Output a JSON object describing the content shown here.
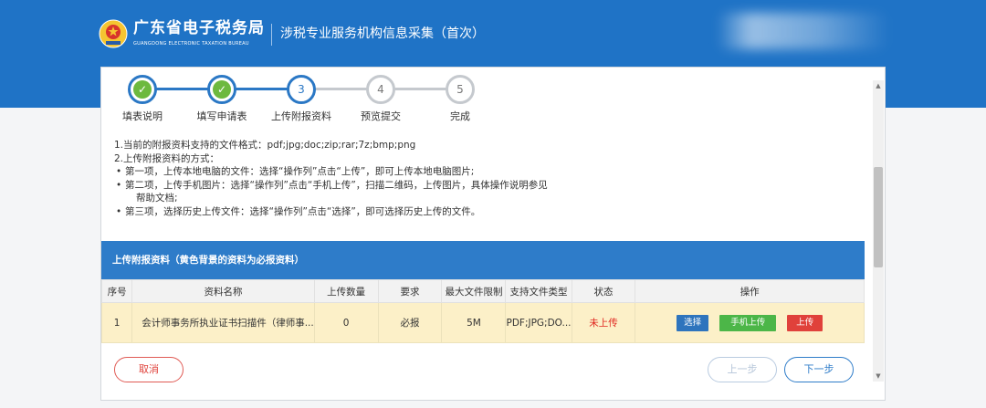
{
  "header": {
    "brand_cn": "广东省电子税务局",
    "brand_en": "GUANGDONG ELECTRONIC TAXATION BUREAU",
    "subtitle": "涉税专业服务机构信息采集（首次）",
    "emblem_icon": "tax-emblem-icon",
    "color": "#1f73c6"
  },
  "steps": [
    {
      "num": "1",
      "label": "填表说明",
      "state": "done"
    },
    {
      "num": "2",
      "label": "填写申请表",
      "state": "done"
    },
    {
      "num": "3",
      "label": "上传附报资料",
      "state": "current"
    },
    {
      "num": "4",
      "label": "预览提交",
      "state": "todo"
    },
    {
      "num": "5",
      "label": "完成",
      "state": "todo"
    }
  ],
  "instructions": {
    "line1": "1.当前的附报资料支持的文件格式：pdf;jpg;doc;zip;rar;7z;bmp;png",
    "line2": "2.上传附报资料的方式：",
    "bullet1": "第一项，上传本地电脑的文件：选择“操作列”点击“上传”，即可上传本地电脑图片;",
    "bullet2": "第二项，上传手机图片：选择“操作列”点击“手机上传”，扫描二维码，上传图片，具体操作说明参见",
    "bullet2_cont": "帮助文档;",
    "bullet3": "第三项，选择历史上传文件：选择“操作列”点击“选择”，即可选择历史上传的文件。"
  },
  "section_title": "上传附报资料（黄色背景的资料为必报资料）",
  "table": {
    "headers": [
      "序号",
      "资料名称",
      "上传数量",
      "要求",
      "最大文件限制",
      "支持文件类型",
      "状态",
      "操作"
    ],
    "rows": [
      {
        "index": "1",
        "name": "会计师事务所执业证书扫描件（律师事...",
        "count": "0",
        "requirement": "必报",
        "max_size": "5M",
        "file_types": "PDF;JPG;DO...",
        "status": "未上传",
        "actions": {
          "select": "选择",
          "mobile": "手机上传",
          "upload": "上传"
        }
      }
    ]
  },
  "footer": {
    "cancel": "取消",
    "prev": "上一步",
    "next": "下一步"
  },
  "colors": {
    "accent": "#2e7cc9",
    "success": "#6db93f",
    "danger": "#e0261f",
    "required_row": "#fcf0c8"
  }
}
